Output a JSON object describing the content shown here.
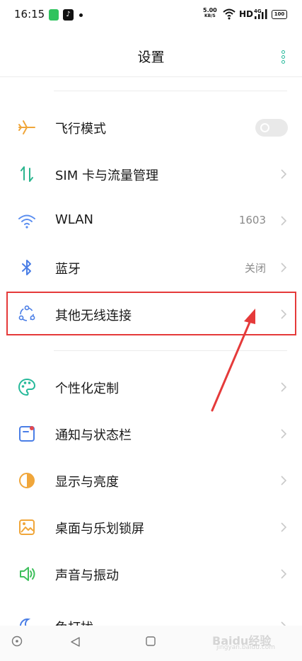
{
  "status_bar": {
    "time": "16:15",
    "app2_glyph": "♪",
    "net_speed": "5.00",
    "net_speed_unit": "KB/S",
    "hd": "HD",
    "network": "4G",
    "battery": "100"
  },
  "header": {
    "title": "设置"
  },
  "settings": {
    "items": [
      {
        "label": "飞行模式",
        "icon": "airplane-icon",
        "control": "toggle",
        "value": "",
        "toggle_on": false
      },
      {
        "label": "SIM 卡与流量管理",
        "icon": "sim-data-icon",
        "control": "chevron",
        "value": ""
      },
      {
        "label": "WLAN",
        "icon": "wifi-icon",
        "control": "chevron",
        "value": "1603"
      },
      {
        "label": "蓝牙",
        "icon": "bluetooth-icon",
        "control": "chevron",
        "value": "关闭"
      },
      {
        "label": "其他无线连接",
        "icon": "connections-icon",
        "control": "chevron",
        "value": ""
      },
      {
        "label": "个性化定制",
        "icon": "palette-icon",
        "control": "chevron",
        "value": ""
      },
      {
        "label": "通知与状态栏",
        "icon": "notification-icon",
        "control": "chevron",
        "value": ""
      },
      {
        "label": "显示与亮度",
        "icon": "brightness-icon",
        "control": "chevron",
        "value": ""
      },
      {
        "label": "桌面与乐划锁屏",
        "icon": "wallpaper-icon",
        "control": "chevron",
        "value": ""
      },
      {
        "label": "声音与振动",
        "icon": "sound-icon",
        "control": "chevron",
        "value": ""
      },
      {
        "label": "免打扰",
        "icon": "moon-icon",
        "control": "chevron",
        "value": ""
      }
    ]
  },
  "annotation": {
    "highlight_color": "#e53a3a",
    "arrow_color": "#e53a3a"
  },
  "colors": {
    "accent": "#26b99a"
  },
  "watermark": {
    "text": "Baidu经验",
    "sub": "jingyan.baidu.com"
  }
}
